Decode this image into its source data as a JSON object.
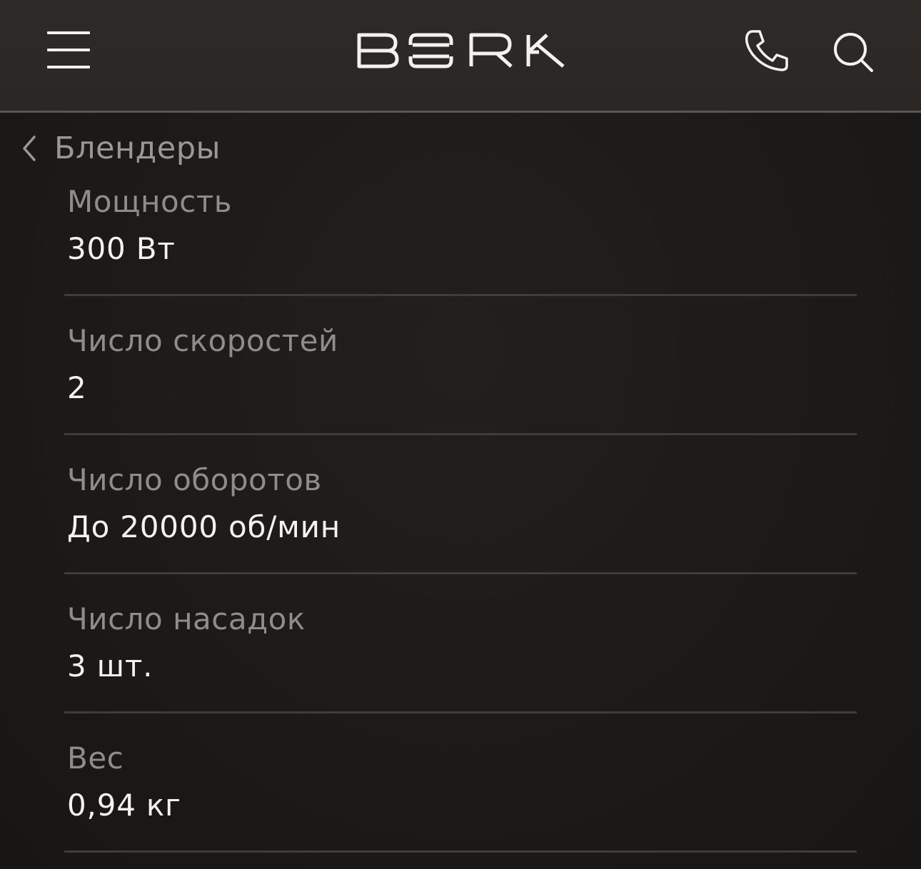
{
  "header": {
    "logo_text": "BORK",
    "menu_icon": "hamburger-menu-icon",
    "phone_icon": "phone-icon",
    "search_icon": "search-icon"
  },
  "breadcrumb": {
    "back_icon": "chevron-left-icon",
    "label": "Блендеры"
  },
  "specs": [
    {
      "label": "Мощность",
      "value": "300 Вт"
    },
    {
      "label": "Число скоростей",
      "value": "2"
    },
    {
      "label": "Число оборотов",
      "value": "До 20000 об/мин"
    },
    {
      "label": "Число насадок",
      "value": "3 шт."
    },
    {
      "label": "Вес",
      "value": "0,94 кг"
    }
  ],
  "colors": {
    "background": "#1c1a18",
    "header_background": "#2b2826",
    "label_text": "#8f8d8b",
    "value_text": "#f4f2f0",
    "divider": "#3f3c39"
  }
}
